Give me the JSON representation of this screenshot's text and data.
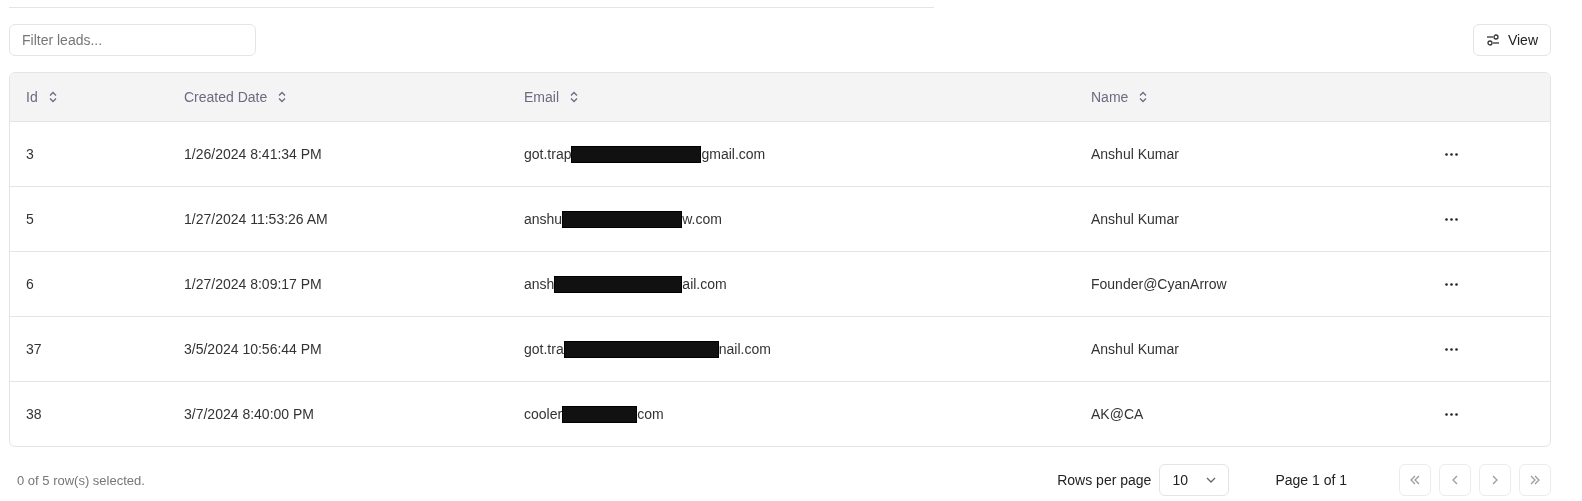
{
  "filter": {
    "placeholder": "Filter leads..."
  },
  "view_button": {
    "label": "View"
  },
  "table": {
    "columns": [
      {
        "label": "Id"
      },
      {
        "label": "Created Date"
      },
      {
        "label": "Email"
      },
      {
        "label": "Name"
      }
    ],
    "rows": [
      {
        "id": "3",
        "created": "1/26/2024 8:41:34 PM",
        "email_start": "got.trap",
        "email_end": "gmail.com",
        "name": "Anshul Kumar"
      },
      {
        "id": "5",
        "created": "1/27/2024 11:53:26 AM",
        "email_start": "anshu",
        "email_end": "w.com",
        "name": "Anshul Kumar"
      },
      {
        "id": "6",
        "created": "1/27/2024 8:09:17 PM",
        "email_start": "ansh",
        "email_end": "ail.com",
        "name": "Founder@CyanArrow"
      },
      {
        "id": "37",
        "created": "3/5/2024 10:56:44 PM",
        "email_start": "got.tra",
        "email_end": "nail.com",
        "name": "Anshul Kumar"
      },
      {
        "id": "38",
        "created": "3/7/2024 8:40:00 PM",
        "email_start": "cooler",
        "email_end": "com",
        "name": "AK@CA"
      }
    ]
  },
  "footer": {
    "selection": "0 of 5 row(s) selected.",
    "rows_per_page_label": "Rows per page",
    "rows_per_page": "10",
    "page": "Page 1 of 1"
  }
}
